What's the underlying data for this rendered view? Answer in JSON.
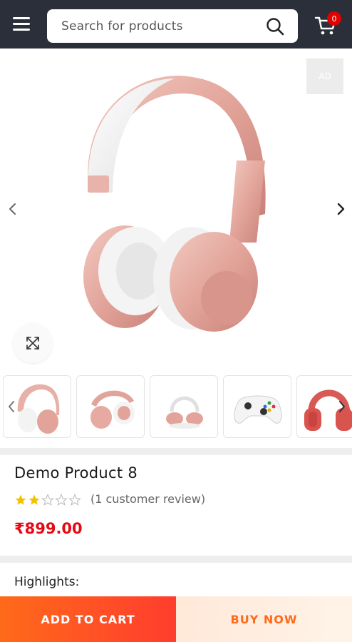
{
  "header": {
    "search_placeholder": "Search for products",
    "cart_count": "0"
  },
  "gallery": {
    "ad_label": "AD",
    "thumbnails": [
      "headphones-front",
      "headphones-folded",
      "headphones-side",
      "game-controller",
      "red-headphones"
    ]
  },
  "product": {
    "title": "Demo Product 8",
    "rating": 2,
    "rating_max": 5,
    "review_text": "(1 customer review)",
    "price": "₹899.00",
    "highlights_label": "Highlights:"
  },
  "actions": {
    "add_to_cart": "ADD TO CART",
    "buy_now": "BUY NOW"
  },
  "colors": {
    "header_bg": "#2a2f3a",
    "accent": "#ff6a1a",
    "price": "#e50914",
    "star": "#f2c200",
    "badge": "#e00000"
  }
}
